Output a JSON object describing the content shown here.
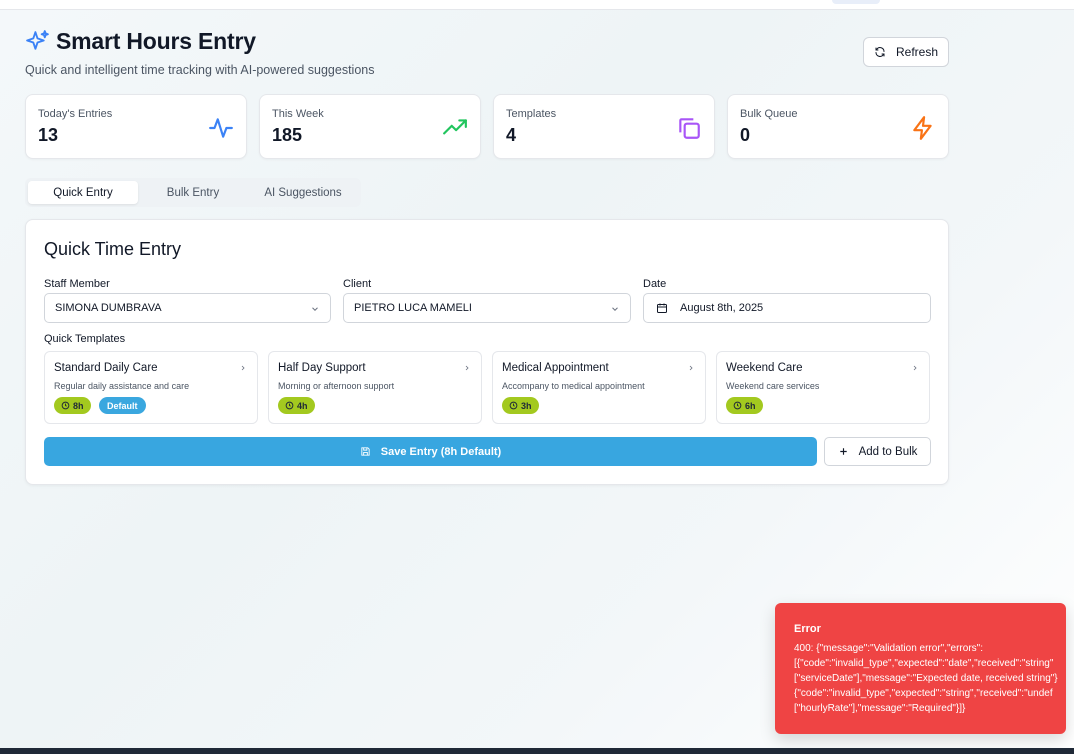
{
  "header": {
    "title": "Smart Hours Entry",
    "subtitle": "Quick and intelligent time tracking with AI-powered suggestions",
    "refresh_label": "Refresh"
  },
  "stats": [
    {
      "label": "Today's Entries",
      "value": "13",
      "icon": "activity-icon",
      "color": "#3b82f6"
    },
    {
      "label": "This Week",
      "value": "185",
      "icon": "trending-up-icon",
      "color": "#22c55e"
    },
    {
      "label": "Templates",
      "value": "4",
      "icon": "copy-icon",
      "color": "#a855f7"
    },
    {
      "label": "Bulk Queue",
      "value": "0",
      "icon": "zap-icon",
      "color": "#f97316"
    }
  ],
  "tabs": [
    {
      "label": "Quick Entry",
      "active": true
    },
    {
      "label": "Bulk Entry",
      "active": false
    },
    {
      "label": "AI Suggestions",
      "active": false
    }
  ],
  "form": {
    "title": "Quick Time Entry",
    "staff_label": "Staff Member",
    "staff_value": "SIMONA DUMBRAVA",
    "client_label": "Client",
    "client_value": "PIETRO LUCA MAMELI",
    "date_label": "Date",
    "date_value": "August 8th, 2025",
    "templates_label": "Quick Templates",
    "templates": [
      {
        "name": "Standard Daily Care",
        "desc": "Regular daily assistance and care",
        "hours": "8h",
        "default": "Default"
      },
      {
        "name": "Half Day Support",
        "desc": "Morning or afternoon support",
        "hours": "4h"
      },
      {
        "name": "Medical Appointment",
        "desc": "Accompany to medical appointment",
        "hours": "3h"
      },
      {
        "name": "Weekend Care",
        "desc": "Weekend care services",
        "hours": "6h"
      }
    ],
    "save_label": "Save Entry (8h Default)",
    "bulk_label": "Add to Bulk"
  },
  "toast": {
    "title": "Error",
    "body": "400: {\"message\":\"Validation error\",\"errors\":\n[{\"code\":\"invalid_type\",\"expected\":\"date\",\"received\":\"string\"\n[\"serviceDate\"],\"message\":\"Expected date, received string\"}\n{\"code\":\"invalid_type\",\"expected\":\"string\",\"received\":\"undef\n[\"hourlyRate\"],\"message\":\"Required\"}]}"
  },
  "colors": {
    "accent": "#38a6e0",
    "hours_badge": "#a3c91f",
    "error": "#ef4444"
  }
}
